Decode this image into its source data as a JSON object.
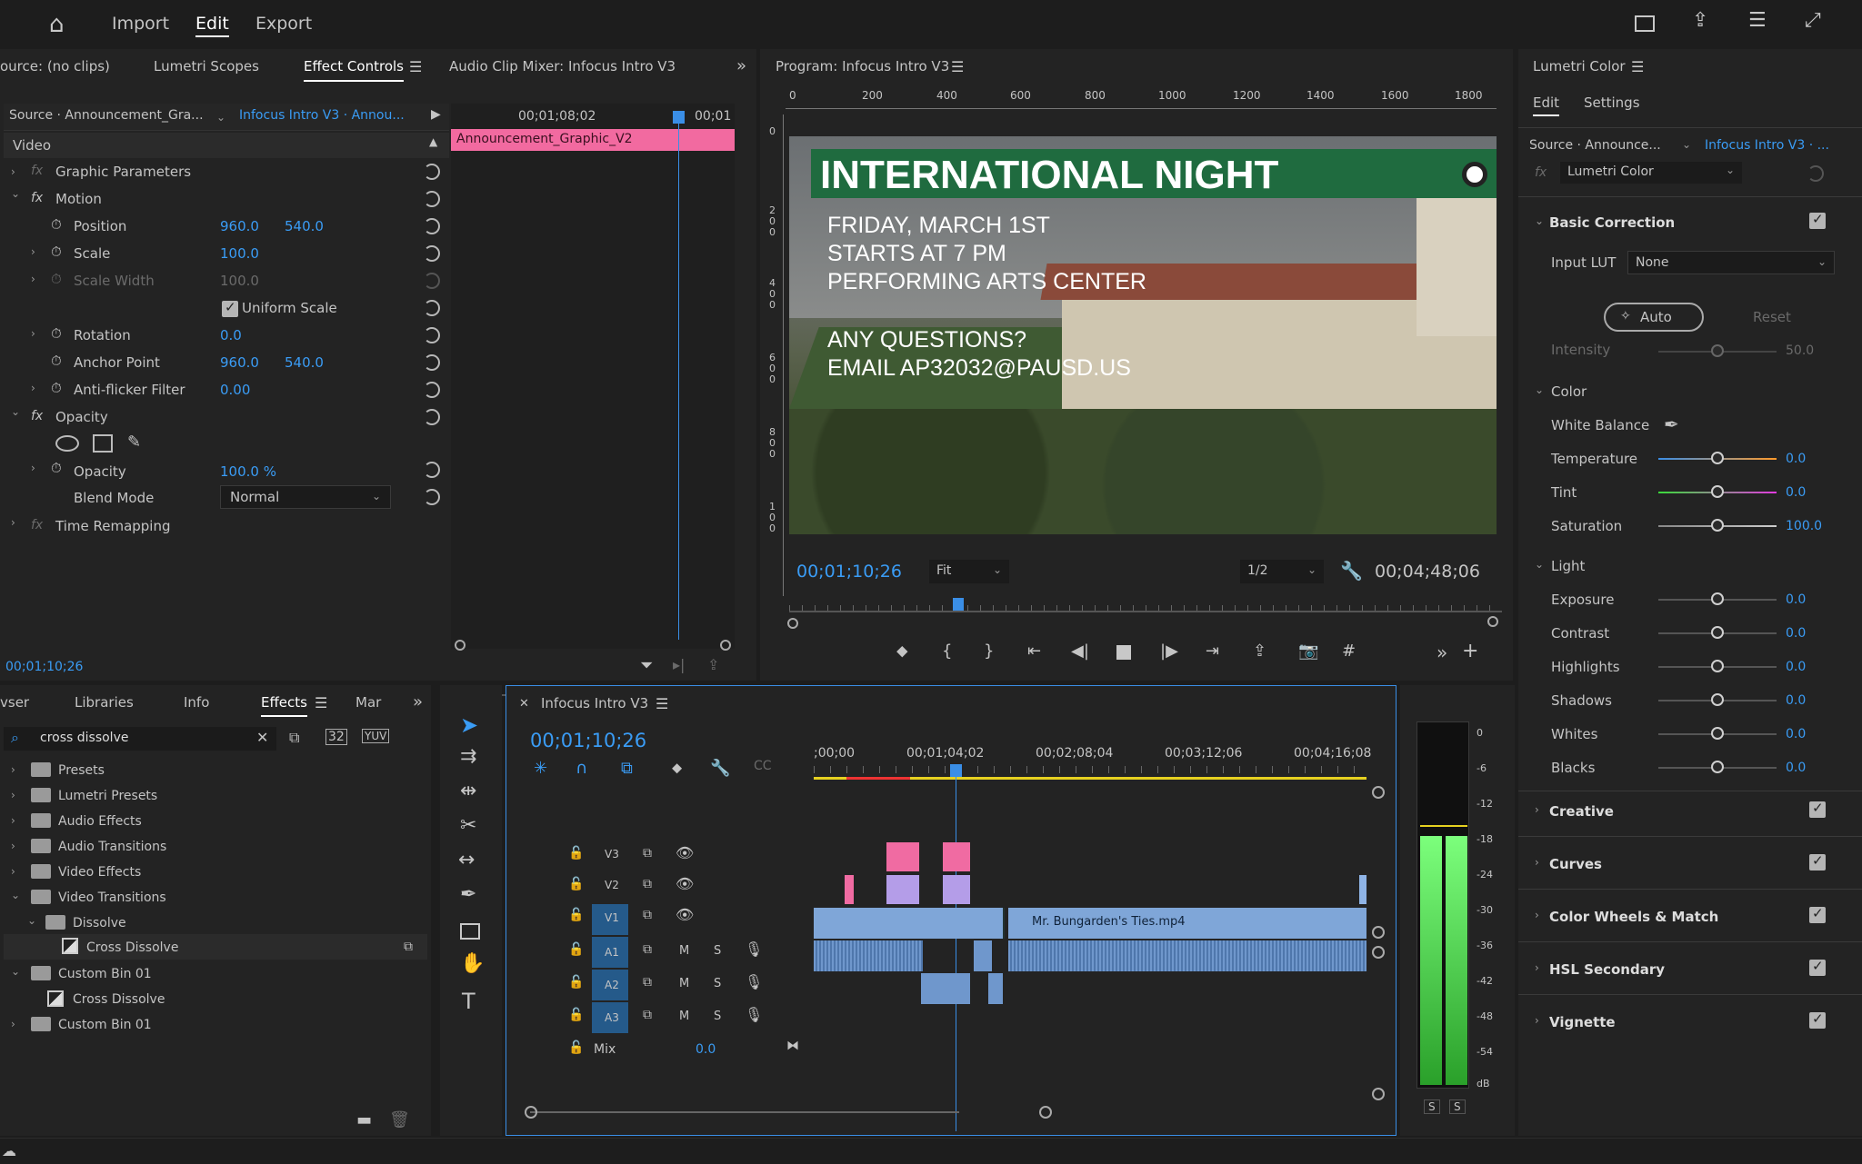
{
  "topbar": {
    "tabs": [
      "Import",
      "Edit",
      "Export"
    ],
    "active": "Edit"
  },
  "source_tabs": {
    "source": "ource: (no clips)",
    "scopes": "Lumetri Scopes",
    "effect_controls": "Effect Controls",
    "audio_mixer": "Audio Clip Mixer: Infocus Intro V3"
  },
  "effect_controls": {
    "source_label": "Source · Announcement_Gra...",
    "sequence_label": "Infocus Intro V3 · Annou...",
    "timecode_ruler": "00;01;08;02",
    "timecode_ruler2": "00;01",
    "clip_name": "Announcement_Graphic_V2",
    "video_header": "Video",
    "graphic_parameters": "Graphic Parameters",
    "motion": "Motion",
    "position": {
      "label": "Position",
      "x": "960.0",
      "y": "540.0"
    },
    "scale": {
      "label": "Scale",
      "value": "100.0"
    },
    "scale_width": {
      "label": "Scale Width",
      "value": "100.0"
    },
    "uniform_scale": "Uniform Scale",
    "rotation": {
      "label": "Rotation",
      "value": "0.0"
    },
    "anchor_point": {
      "label": "Anchor Point",
      "x": "960.0",
      "y": "540.0"
    },
    "anti_flicker": {
      "label": "Anti-flicker Filter",
      "value": "0.00"
    },
    "opacity_group": "Opacity",
    "opacity": {
      "label": "Opacity",
      "value": "100.0 %"
    },
    "blend_mode": {
      "label": "Blend Mode",
      "value": "Normal"
    },
    "time_remapping": "Time Remapping",
    "timecode": "00;01;10;26"
  },
  "program": {
    "title": "Program: Infocus Intro V3",
    "ruler": [
      "0",
      "200",
      "400",
      "600",
      "800",
      "1000",
      "1200",
      "1400",
      "1600",
      "1800"
    ],
    "vruler": [
      "0",
      "2 0 0",
      "4 0 0",
      "6 0 0",
      "8 0 0",
      "1 0 0"
    ],
    "banner": "INTERNATIONAL NIGHT",
    "lines": [
      "FRIDAY, MARCH 1ST",
      "STARTS AT 7 PM",
      "PERFORMING ARTS CENTER"
    ],
    "lines2": [
      "ANY QUESTIONS?",
      "EMAIL AP32032@PAUSD.US"
    ],
    "timecode": "00;01;10;26",
    "fit": "Fit",
    "resolution": "1/2",
    "duration": "00;04;48;06"
  },
  "lumetri": {
    "title": "Lumetri Color",
    "tabs": [
      "Edit",
      "Settings"
    ],
    "source": "Source · Announce...",
    "sequence": "Infocus Intro V3 · ...",
    "effect": "Lumetri Color",
    "basic_correction": "Basic Correction",
    "input_lut": {
      "label": "Input LUT",
      "value": "None"
    },
    "auto": "Auto",
    "reset": "Reset",
    "intensity": {
      "label": "Intensity",
      "value": "50.0"
    },
    "color": "Color",
    "white_balance": "White Balance",
    "temperature": {
      "label": "Temperature",
      "value": "0.0"
    },
    "tint": {
      "label": "Tint",
      "value": "0.0"
    },
    "saturation": {
      "label": "Saturation",
      "value": "100.0"
    },
    "light": "Light",
    "exposure": {
      "label": "Exposure",
      "value": "0.0"
    },
    "contrast": {
      "label": "Contrast",
      "value": "0.0"
    },
    "highlights": {
      "label": "Highlights",
      "value": "0.0"
    },
    "shadows": {
      "label": "Shadows",
      "value": "0.0"
    },
    "whites": {
      "label": "Whites",
      "value": "0.0"
    },
    "blacks": {
      "label": "Blacks",
      "value": "0.0"
    },
    "sections": [
      "Creative",
      "Curves",
      "Color Wheels & Match",
      "HSL Secondary",
      "Vignette"
    ]
  },
  "project": {
    "tabs": [
      "vser",
      "Libraries",
      "Info",
      "Effects",
      "Mar"
    ],
    "active": "Effects",
    "search": "cross dissolve",
    "items": [
      "Presets",
      "Lumetri Presets",
      "Audio Effects",
      "Audio Transitions",
      "Video Effects",
      "Video Transitions",
      "Dissolve",
      "Cross Dissolve",
      "Custom Bin 01",
      "Cross Dissolve",
      "Custom Bin 01"
    ]
  },
  "timeline": {
    "title": "Infocus Intro V3",
    "timecode": "00;01;10;26",
    "ruler": [
      ";00;00",
      "00;01;04;02",
      "00;02;08;04",
      "00;03;12;06",
      "00;04;16;08"
    ],
    "tracks": [
      "V3",
      "V2",
      "V1",
      "A1",
      "A2",
      "A3"
    ],
    "mix": {
      "label": "Mix",
      "value": "0.0"
    },
    "clip_v1": "Mr. Bungarden's Ties.mp4"
  },
  "meter": {
    "scale": [
      "0",
      "-6",
      "-12",
      "-18",
      "-24",
      "-30",
      "-36",
      "-42",
      "-48",
      "-54",
      "dB"
    ],
    "solo": [
      "S",
      "S"
    ]
  }
}
